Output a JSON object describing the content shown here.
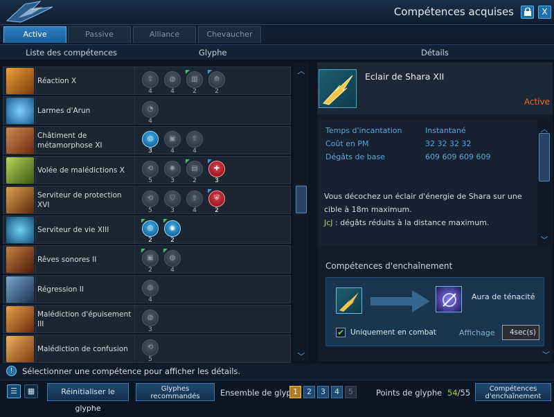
{
  "window": {
    "title": "Compétences acquises",
    "lock_icon": "lock-icon",
    "close_label": "X"
  },
  "tabs": [
    {
      "label": "Active",
      "active": true
    },
    {
      "label": "Passive",
      "active": false
    },
    {
      "label": "Alliance",
      "active": false
    },
    {
      "label": "Chevaucher",
      "active": false
    }
  ],
  "headers": {
    "list": "Liste des compétences",
    "glyph": "Glyphe",
    "details": "Détails"
  },
  "skills": [
    {
      "name": "Réaction X",
      "glyphs": [
        "4",
        "4",
        "2",
        "2"
      ]
    },
    {
      "name": "Larmes d'Arun",
      "glyphs": [
        "4"
      ]
    },
    {
      "name": "Châtiment de métamorphose XI",
      "glyphs": [
        "3",
        "4",
        "4"
      ]
    },
    {
      "name": "Volée de malédictions X",
      "glyphs": [
        "5",
        "3",
        "2",
        "3"
      ]
    },
    {
      "name": "Serviteur de protection XVI",
      "glyphs": [
        "5",
        "3",
        "4",
        "2"
      ]
    },
    {
      "name": "Serviteur de vie XIII",
      "glyphs": [
        "2",
        "2"
      ]
    },
    {
      "name": "Rêves sonores II",
      "glyphs": [
        "2",
        "4"
      ]
    },
    {
      "name": "Régression II",
      "glyphs": [
        "4"
      ]
    },
    {
      "name": "Malédiction d'épuisement III",
      "glyphs": [
        "3"
      ]
    },
    {
      "name": "Malédiction de confusion",
      "glyphs": [
        "5"
      ]
    }
  ],
  "detail": {
    "name": "Eclair de Shara XII",
    "type": "Active",
    "props": [
      {
        "label": "Temps d'incantation",
        "value": "Instantané"
      },
      {
        "label": "Coût en PM",
        "value": "32 32 32 32"
      },
      {
        "label": "Dégâts de base",
        "value": "609 609 609 609"
      }
    ],
    "description": "Vous décochez un éclair d'énergie de Shara sur une cible à 18m maximum.",
    "note_tag": "JcJ",
    "note": " : dégâts réduits à la distance maximum.",
    "chain_title": "Compétences d'enchaînement",
    "chain_target": "Aura de ténacité",
    "combat_only": "Uniquement en combat",
    "display_label": "Affichage",
    "display_value": "4sec(s)"
  },
  "status": {
    "text": "Sélectionner une compétence pour afficher les détails.",
    "info_icon": "!"
  },
  "bottom": {
    "list_view": "☰",
    "grid_view": "▦",
    "reset": "Réinitialiser le glyphe",
    "recommended_l1": "Glyphes",
    "recommended_l2": "recommandés",
    "set_label": "Ensemble de glyp",
    "sets": [
      "1",
      "2",
      "3",
      "4",
      "5"
    ],
    "points_label": "Points de glyphe",
    "points_used": "54",
    "points_total": "/55",
    "chain_l1": "Compétences",
    "chain_l2": "d'enchaînement"
  },
  "colors": {
    "accent": "#1f6fa8",
    "active_type": "#e86a28",
    "highlight": "#5ea6da"
  }
}
